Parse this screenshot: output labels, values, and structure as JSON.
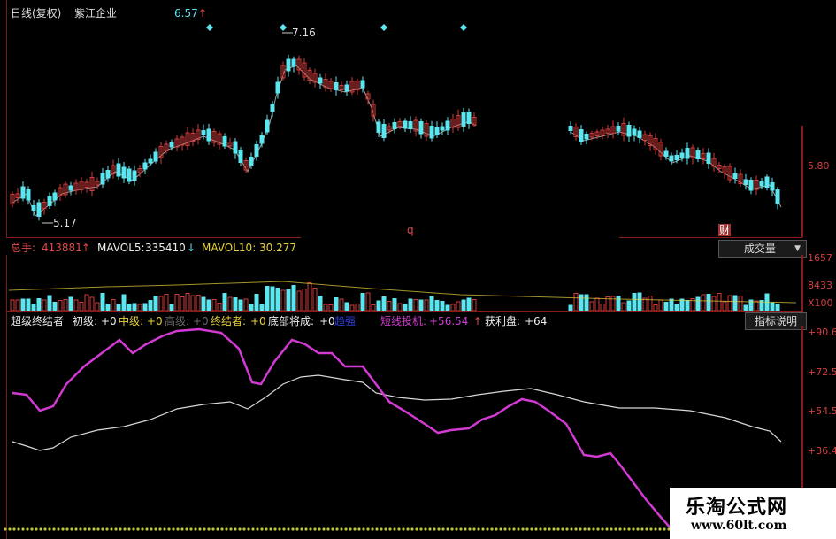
{
  "header": {
    "chart_mode": "日线(复权)",
    "stock_name": "紫江企业",
    "price_marker": "6.57",
    "price_marker_arrow": "↑"
  },
  "price_panel": {
    "annotations": {
      "high": "7.16",
      "low": "5.17",
      "q_mark": "q",
      "cai_mark": "财"
    },
    "right_tick": "5.80"
  },
  "volume_panel": {
    "total_label": "总手:",
    "total_value": "413881",
    "total_arrow": "↑",
    "ma5_label": "MAVOL5:",
    "ma5_value": "335410",
    "ma5_arrow": "↓",
    "ma10_partial": "MAVOL10: 30.277",
    "dropdown_label": "成交量",
    "dropdown_caret": "▼",
    "ticks": [
      "1657",
      "8433",
      "X100"
    ]
  },
  "indicator_panel": {
    "title": "超级终结者",
    "items": [
      {
        "label": "初级:",
        "value": "+0"
      },
      {
        "label": "中级:",
        "value": "+0"
      },
      {
        "label": "高级:",
        "value": "+0"
      },
      {
        "label": "终结者:",
        "value": "+0"
      },
      {
        "label": "底部将成:",
        "value": "+0"
      },
      {
        "label": "趋强",
        "value": ""
      },
      {
        "label": "短线投机:",
        "value": "+56.54"
      },
      {
        "label": "获利盘:",
        "value": "+64"
      }
    ],
    "trend_arrow": "↑",
    "explain_button": "指标说明",
    "ticks": [
      "+90.6",
      "+72.5",
      "+54.5",
      "+36.4"
    ]
  },
  "watermark": {
    "line1": "乐淘公式网",
    "line2": "www.60lt.com"
  },
  "colors": {
    "up": "#d23a3a",
    "down": "#5ce6ef",
    "magenta": "#d23ad2",
    "white_line": "#d8d8d8",
    "axis": "#8b1a1a",
    "yellow": "#e8d23a"
  }
}
